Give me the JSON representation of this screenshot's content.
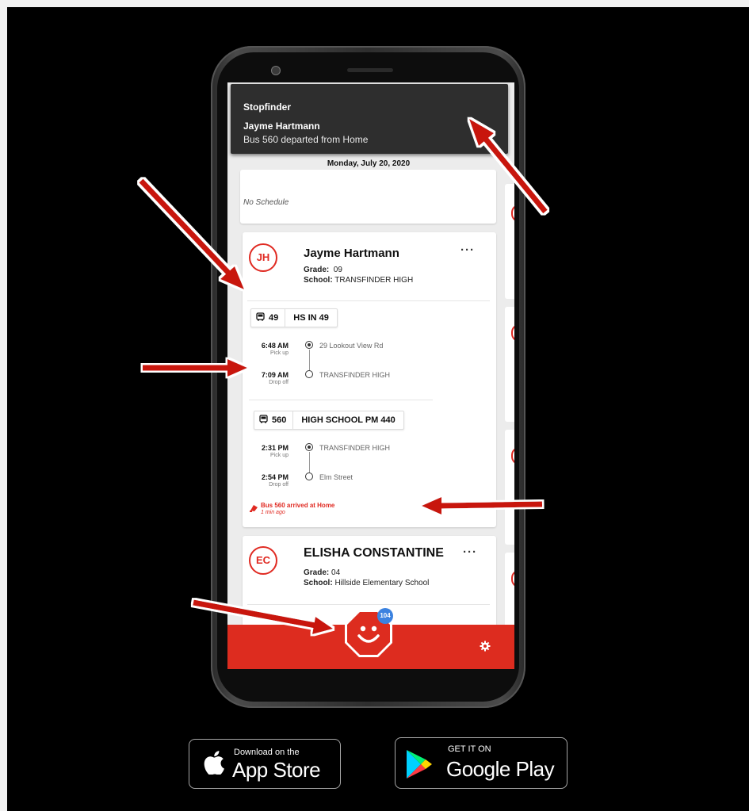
{
  "notification": {
    "app": "Stopfinder",
    "title": "Jayme Hartmann",
    "body": "Bus 560 departed from Home"
  },
  "date_header": "Monday, July 20, 2020",
  "no_schedule": "No Schedule",
  "student1": {
    "initials": "JH",
    "name": "Jayme Hartmann",
    "grade_label": "Grade:",
    "grade": "09",
    "school_label": "School:",
    "school": "TRANSFINDER HIGH",
    "routes": [
      {
        "number": "49",
        "name": "HS IN 49",
        "stops": [
          {
            "time": "6:48 AM",
            "type": "Pick up",
            "place": "29 Lookout View Rd"
          },
          {
            "time": "7:09 AM",
            "type": "Drop off",
            "place": "TRANSFINDER HIGH"
          }
        ]
      },
      {
        "number": "560",
        "name": "HIGH SCHOOL PM 440",
        "stops": [
          {
            "time": "2:31 PM",
            "type": "Pick up",
            "place": "TRANSFINDER HIGH"
          },
          {
            "time": "2:54 PM",
            "type": "Drop off",
            "place": "Elm Street"
          }
        ]
      }
    ],
    "alert": "Bus 560 arrived at Home",
    "alert_time": "1 min ago"
  },
  "student2": {
    "initials": "EC",
    "name": "ELISHA CONSTANTINE",
    "grade_label": "Grade:",
    "grade": "04",
    "school_label": "School:",
    "school": "Hillside Elementary School"
  },
  "more_label": "···",
  "fab_badge": "104",
  "stores": {
    "apple_small": "Download on the",
    "apple_big": "App Store",
    "google_small": "GET IT ON",
    "google_big": "Google Play"
  },
  "colors": {
    "accent": "#dd2c1f",
    "arrow": "#c8120b",
    "badge": "#3b82e0"
  }
}
